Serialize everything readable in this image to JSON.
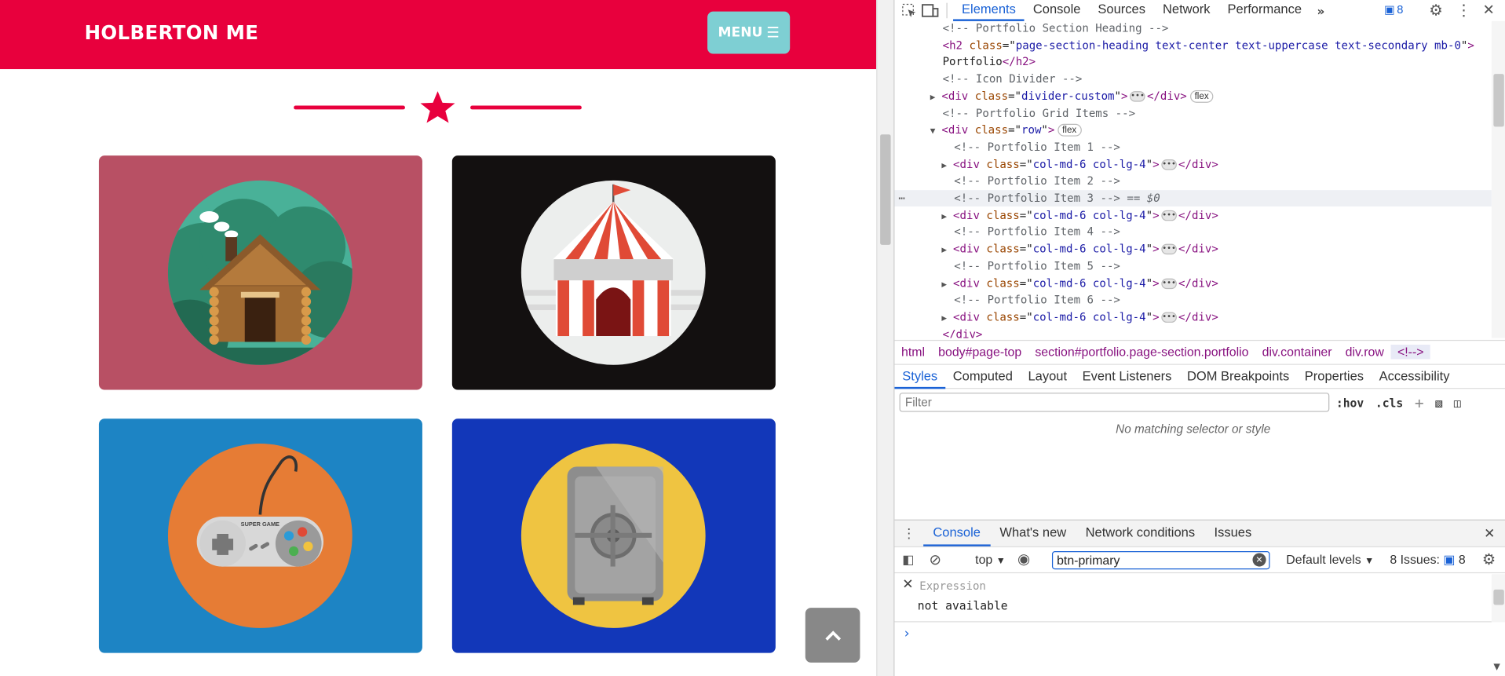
{
  "site": {
    "brand": "HOLBERTON ME",
    "menu_label": "MENU",
    "colors": {
      "navbar": "#e8003d",
      "menu_button": "#7ecfd3",
      "accent": "#e8003d"
    }
  },
  "portfolio_cards": [
    {
      "icon": "cabin-icon",
      "bg": "#b85064"
    },
    {
      "icon": "circus-tent-icon",
      "bg": "#131010"
    },
    {
      "icon": "game-controller-icon",
      "bg": "#1d84c4"
    },
    {
      "icon": "safe-icon",
      "bg": "#1237b9"
    }
  ],
  "devtools": {
    "tabs": [
      "Elements",
      "Console",
      "Sources",
      "Network",
      "Performance"
    ],
    "active_tab": "Elements",
    "issues_count": "8",
    "dom_lines": [
      {
        "indent": 0,
        "kind": "comment",
        "text": "<!-- Portfolio Section Heading -->"
      },
      {
        "indent": 0,
        "kind": "h2open",
        "tag": "h2",
        "attr": "class",
        "value": "page-section-heading text-center text-uppercase text-secondary mb-0"
      },
      {
        "indent": 0,
        "kind": "h2close",
        "text": "Portfolio",
        "close": "</h2>"
      },
      {
        "indent": 0,
        "kind": "comment",
        "text": "<!-- Icon Divider -->"
      },
      {
        "indent": 0,
        "kind": "collapsed",
        "tag": "div",
        "attr": "class",
        "value": "divider-custom",
        "badge": "flex"
      },
      {
        "indent": 0,
        "kind": "comment",
        "text": "<!-- Portfolio Grid Items -->"
      },
      {
        "indent": 0,
        "kind": "open",
        "tag": "div",
        "attr": "class",
        "value": "row",
        "badge": "flex"
      },
      {
        "indent": 1,
        "kind": "comment",
        "text": "<!-- Portfolio Item 1 -->"
      },
      {
        "indent": 1,
        "kind": "collapsed",
        "tag": "div",
        "attr": "class",
        "value": "col-md-6 col-lg-4"
      },
      {
        "indent": 1,
        "kind": "comment",
        "text": "<!-- Portfolio Item 2 -->"
      },
      {
        "indent": 1,
        "kind": "selected",
        "text": "<!-- Portfolio Item 3 -->",
        "suffix": " == $0"
      },
      {
        "indent": 1,
        "kind": "collapsed",
        "tag": "div",
        "attr": "class",
        "value": "col-md-6 col-lg-4"
      },
      {
        "indent": 1,
        "kind": "comment",
        "text": "<!-- Portfolio Item 4 -->"
      },
      {
        "indent": 1,
        "kind": "collapsed",
        "tag": "div",
        "attr": "class",
        "value": "col-md-6 col-lg-4"
      },
      {
        "indent": 1,
        "kind": "comment",
        "text": "<!-- Portfolio Item 5 -->"
      },
      {
        "indent": 1,
        "kind": "collapsed",
        "tag": "div",
        "attr": "class",
        "value": "col-md-6 col-lg-4"
      },
      {
        "indent": 1,
        "kind": "comment",
        "text": "<!-- Portfolio Item 6 -->"
      },
      {
        "indent": 1,
        "kind": "collapsed",
        "tag": "div",
        "attr": "class",
        "value": "col-md-6 col-lg-4"
      },
      {
        "indent": 0,
        "kind": "closeonly",
        "text": "</div>"
      }
    ],
    "breadcrumbs": [
      "html",
      "body#page-top",
      "section#portfolio.page-section.portfolio",
      "div.container",
      "div.row",
      "<!-->"
    ],
    "style_tabs": [
      "Styles",
      "Computed",
      "Layout",
      "Event Listeners",
      "DOM Breakpoints",
      "Properties",
      "Accessibility"
    ],
    "filter_placeholder": "Filter",
    "hov_label": ":hov",
    "cls_label": ".cls",
    "no_match": "No matching selector or style",
    "drawer_tabs": [
      "Console",
      "What's new",
      "Network conditions",
      "Issues"
    ],
    "context": "top",
    "console_filter": "btn-primary",
    "levels": "Default levels",
    "issues_label": "8 Issues:",
    "issues_num": "8",
    "expression_placeholder": "Expression",
    "expression_value": "not available"
  }
}
